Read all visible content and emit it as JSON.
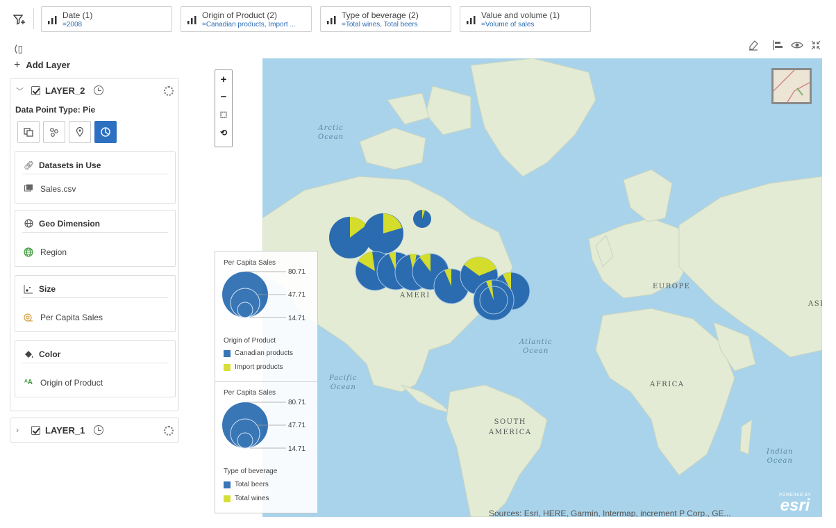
{
  "filters": [
    {
      "name": "Date (1)",
      "value": "=2008"
    },
    {
      "name": "Origin of Product (2)",
      "value": "=Canadian products, Import ..."
    },
    {
      "name": "Type of beverage (2)",
      "value": "=Total wines, Total beers"
    },
    {
      "name": "Value and volume (1)",
      "value": "=Volume of sales"
    }
  ],
  "panel": {
    "add_layer": "Add Layer",
    "layer2": {
      "name": "LAYER_2",
      "data_point_type": "Data Point Type: Pie",
      "datasets_title": "Datasets in Use",
      "dataset": "Sales.csv",
      "geo_title": "Geo Dimension",
      "geo_item": "Region",
      "size_title": "Size",
      "size_item": "Per Capita Sales",
      "color_title": "Color",
      "color_item": "Origin of Product"
    },
    "layer1": {
      "name": "LAYER_1"
    }
  },
  "map": {
    "labels": {
      "arctic_1": "Arctic",
      "arctic_2": "Ocean",
      "atlantic_1": "Atlantic",
      "atlantic_2": "Ocean",
      "pacific_1": "Pacific",
      "pacific_2": "Ocean",
      "indian_1": "Indian",
      "indian_2": "Ocean",
      "europe": "EUROPE",
      "africa": "AFRICA",
      "south_1": "SOUTH",
      "south_2": "AMERICA",
      "america": "AMERI",
      "asia": "ASI"
    },
    "attribution": "Sources: Esri, HERE, Garmin, Intermap, increment P Corp., GE...",
    "esri_powered": "POWERED BY",
    "esri_logo": "esri"
  },
  "legend": {
    "size_title_1": "Per Capita Sales",
    "size_values_1": [
      "80.71",
      "47.71",
      "14.71"
    ],
    "color_title_1": "Origin of Product",
    "color_items_1": [
      {
        "label": "Canadian products",
        "color": "#2b6cb0"
      },
      {
        "label": "Import products",
        "color": "#d4dc2c"
      }
    ],
    "size_title_2": "Per Capita Sales",
    "size_values_2": [
      "80.71",
      "47.71",
      "14.71"
    ],
    "color_title_2": "Type of beverage",
    "color_items_2": [
      {
        "label": "Total beers",
        "color": "#2b6cb0"
      },
      {
        "label": "Total wines",
        "color": "#d4dc2c"
      }
    ]
  },
  "colors": {
    "pie_primary": "#2b6cb0",
    "pie_secondary": "#d4dc2c",
    "accent": "#2d6fc1",
    "ocean": "#a9d3ea",
    "land": "#e4ecd7"
  },
  "icons": {
    "filter": "filter-add-icon",
    "chip": "bar-chart-icon",
    "eraser": "eraser-icon",
    "align": "align-left-icon",
    "eye": "eye-icon",
    "collapse": "collapse-icon"
  }
}
